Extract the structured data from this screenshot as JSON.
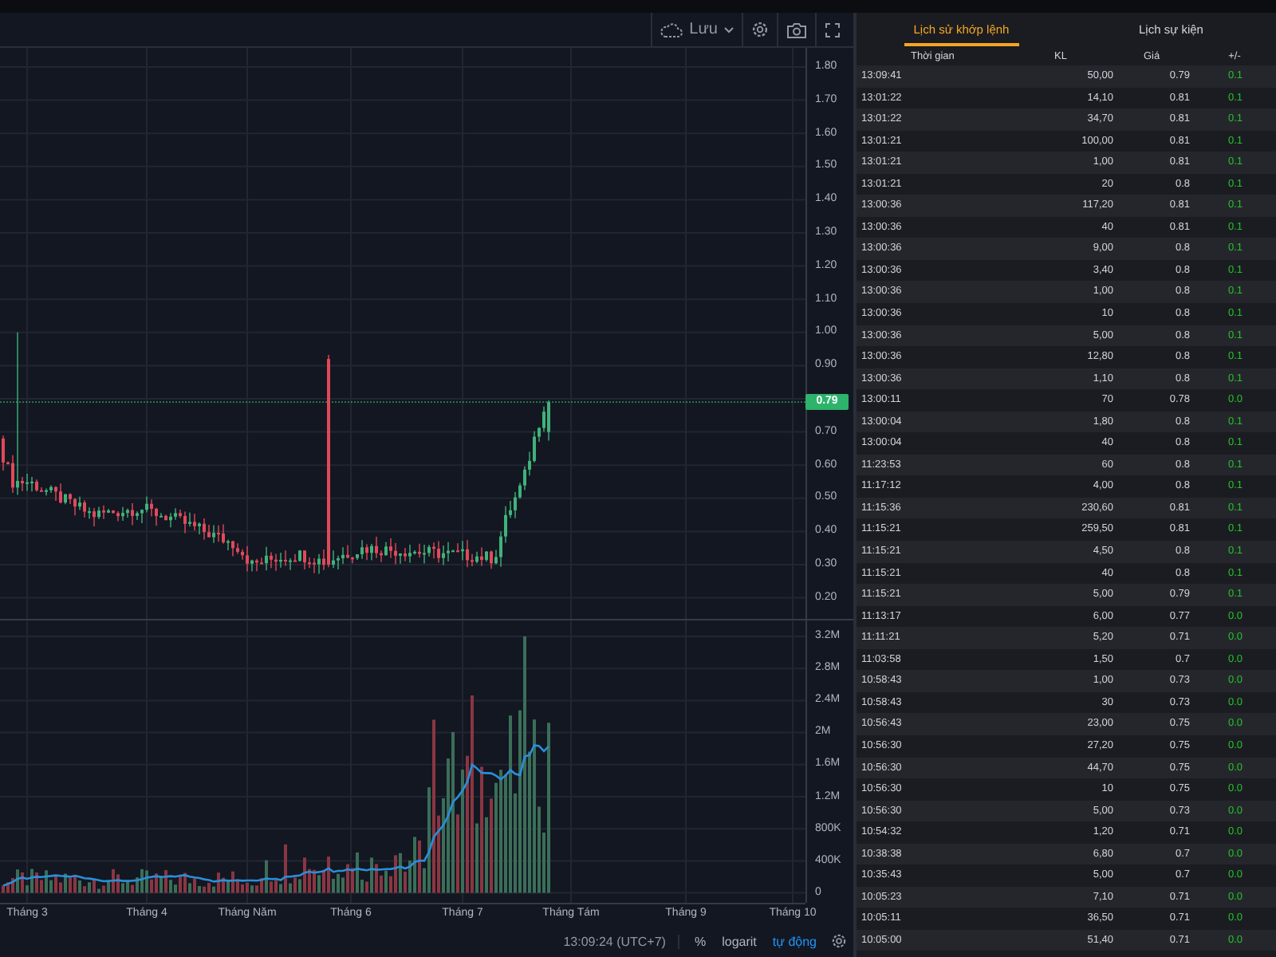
{
  "toolbar": {
    "save_label": "Lưu"
  },
  "chart": {
    "price_axis": [
      "1.80",
      "1.70",
      "1.60",
      "1.50",
      "1.40",
      "1.30",
      "1.20",
      "1.10",
      "1.00",
      "0.90",
      "0.70",
      "0.60",
      "0.50",
      "0.40",
      "0.30",
      "0.20"
    ],
    "current_price": "0.79",
    "volume_axis": [
      "3.2M",
      "2.8M",
      "2.4M",
      "2M",
      "1.6M",
      "1.2M",
      "800K",
      "400K",
      "0"
    ],
    "time_axis": [
      "Tháng 3",
      "Tháng 4",
      "Tháng Năm",
      "Tháng 6",
      "Tháng 7",
      "Tháng Tám",
      "Tháng 9",
      "Tháng 10"
    ]
  },
  "status_bar": {
    "clock": "13:09:24 (UTC+7)",
    "scale_modes": [
      {
        "label": "%",
        "selected": false
      },
      {
        "label": "logarit",
        "selected": false
      },
      {
        "label": "tự động",
        "selected": true
      }
    ]
  },
  "panel": {
    "tabs": [
      {
        "label": "Lịch sử khớp lệnh",
        "selected": true
      },
      {
        "label": "Lịch sự kiện",
        "selected": false
      }
    ],
    "columns": [
      "Thời gian",
      "KL",
      "Giá",
      "+/-"
    ],
    "rows": [
      [
        "13:09:41",
        "50,00",
        "0.79",
        "0.1"
      ],
      [
        "13:01:22",
        "14,10",
        "0.81",
        "0.1"
      ],
      [
        "13:01:22",
        "34,70",
        "0.81",
        "0.1"
      ],
      [
        "13:01:21",
        "100,00",
        "0.81",
        "0.1"
      ],
      [
        "13:01:21",
        "1,00",
        "0.81",
        "0.1"
      ],
      [
        "13:01:21",
        "20",
        "0.8",
        "0.1"
      ],
      [
        "13:00:36",
        "117,20",
        "0.81",
        "0.1"
      ],
      [
        "13:00:36",
        "40",
        "0.81",
        "0.1"
      ],
      [
        "13:00:36",
        "9,00",
        "0.8",
        "0.1"
      ],
      [
        "13:00:36",
        "3,40",
        "0.8",
        "0.1"
      ],
      [
        "13:00:36",
        "1,00",
        "0.8",
        "0.1"
      ],
      [
        "13:00:36",
        "10",
        "0.8",
        "0.1"
      ],
      [
        "13:00:36",
        "5,00",
        "0.8",
        "0.1"
      ],
      [
        "13:00:36",
        "12,80",
        "0.8",
        "0.1"
      ],
      [
        "13:00:36",
        "1,10",
        "0.8",
        "0.1"
      ],
      [
        "13:00:11",
        "70",
        "0.78",
        "0.0"
      ],
      [
        "13:00:04",
        "1,80",
        "0.8",
        "0.1"
      ],
      [
        "13:00:04",
        "40",
        "0.8",
        "0.1"
      ],
      [
        "11:23:53",
        "60",
        "0.8",
        "0.1"
      ],
      [
        "11:17:12",
        "4,00",
        "0.8",
        "0.1"
      ],
      [
        "11:15:36",
        "230,60",
        "0.81",
        "0.1"
      ],
      [
        "11:15:21",
        "259,50",
        "0.81",
        "0.1"
      ],
      [
        "11:15:21",
        "4,50",
        "0.8",
        "0.1"
      ],
      [
        "11:15:21",
        "40",
        "0.8",
        "0.1"
      ],
      [
        "11:15:21",
        "5,00",
        "0.79",
        "0.1"
      ],
      [
        "11:13:17",
        "6,00",
        "0.77",
        "0.0"
      ],
      [
        "11:11:21",
        "5,20",
        "0.71",
        "0.0"
      ],
      [
        "11:03:58",
        "1,50",
        "0.7",
        "0.0"
      ],
      [
        "10:58:43",
        "1,00",
        "0.73",
        "0.0"
      ],
      [
        "10:58:43",
        "30",
        "0.73",
        "0.0"
      ],
      [
        "10:56:43",
        "23,00",
        "0.75",
        "0.0"
      ],
      [
        "10:56:30",
        "27,20",
        "0.75",
        "0.0"
      ],
      [
        "10:56:30",
        "44,70",
        "0.75",
        "0.0"
      ],
      [
        "10:56:30",
        "10",
        "0.75",
        "0.0"
      ],
      [
        "10:56:30",
        "5,00",
        "0.73",
        "0.0"
      ],
      [
        "10:54:32",
        "1,20",
        "0.71",
        "0.0"
      ],
      [
        "10:38:38",
        "6,80",
        "0.7",
        "0.0"
      ],
      [
        "10:35:43",
        "5,00",
        "0.7",
        "0.0"
      ],
      [
        "10:05:23",
        "7,10",
        "0.71",
        "0.0"
      ],
      [
        "10:05:11",
        "36,50",
        "0.71",
        "0.0"
      ],
      [
        "10:05:00",
        "51,40",
        "0.71",
        "0.0"
      ]
    ]
  }
}
